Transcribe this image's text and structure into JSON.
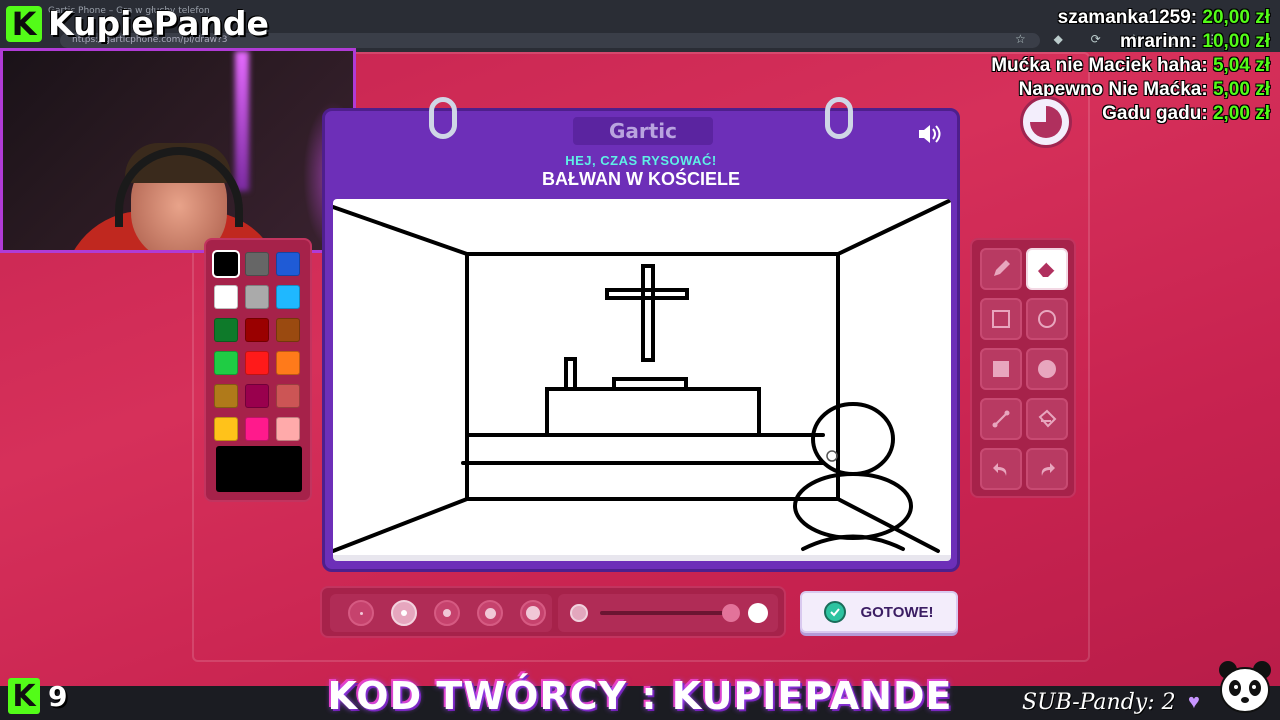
{
  "browser": {
    "tab_title": "Gartic Phone – Gra w głuchy telefon",
    "url": "https://garticphone.com/pl/draw?3"
  },
  "brand": {
    "logo_letter": "K",
    "name": "KupiePande"
  },
  "donations": [
    {
      "name": "szamanka1259:",
      "amount": "20,00 zł"
    },
    {
      "name": "mrarinn:",
      "amount": "10,00 zł"
    },
    {
      "name": "Mućka nie Maciek haha:",
      "amount": "5,04 zł"
    },
    {
      "name": "Napewno Nie Maćka:",
      "amount": "5,00 zł"
    },
    {
      "name": "Gadu gadu:",
      "amount": "2,00 zł"
    }
  ],
  "game": {
    "logo": "Gartic",
    "prompt_sub": "HEJ, CZAS RYSOWAĆ!",
    "prompt_word": "BAŁWAN W KOŚCIELE",
    "done_label": "GOTOWE!",
    "timer_progress": 0.75
  },
  "palette": [
    "#000000",
    "#666666",
    "#1f5bd6",
    "#ffffff",
    "#aaaaaa",
    "#1fb8ff",
    "#0e7a2a",
    "#9a0000",
    "#9a4a10",
    "#1fcc44",
    "#ff1a1a",
    "#ff7a1a",
    "#b07a1a",
    "#99004d",
    "#cc5555",
    "#ffc21a",
    "#ff1a8c",
    "#ffaaaa"
  ],
  "current_color": "#000000",
  "tools": [
    "pencil-icon",
    "eraser-icon",
    "rectangle-outline-icon",
    "ellipse-outline-icon",
    "rectangle-fill-icon",
    "ellipse-fill-icon",
    "line-icon",
    "bucket-icon",
    "undo-icon",
    "redo-icon"
  ],
  "stroke_sizes": 5,
  "stream": {
    "kick_letter": "K",
    "viewer_count": "9",
    "creator_code": "KOD TWÓRCY : KUPIEPANDE",
    "sub_goal": "SUB-Pandy: 2"
  }
}
